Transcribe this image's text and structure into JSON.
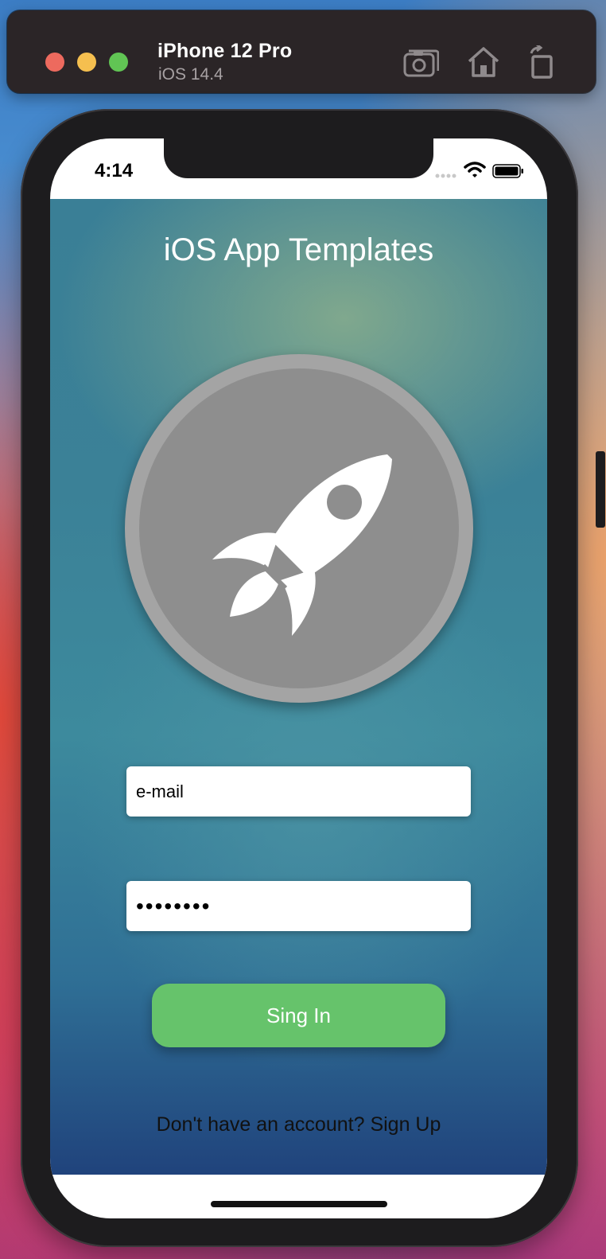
{
  "simulator": {
    "device_name": "iPhone 12 Pro",
    "os_version": "iOS 14.4",
    "toolbar": {
      "screenshot_icon": "camera-icon",
      "home_icon": "home-icon",
      "rotate_icon": "rotate-icon"
    }
  },
  "status_bar": {
    "time": "4:14",
    "wifi_icon": "wifi-icon",
    "battery_icon": "battery-icon"
  },
  "app": {
    "title": "iOS App Templates",
    "logo_icon": "rocket-icon",
    "email_placeholder": "e-mail",
    "email_value": "e-mail",
    "password_value": "••••••••",
    "signin_label": "Sing In",
    "signup_prompt": "Don't have an account? ",
    "signup_link": "Sign Up"
  },
  "colors": {
    "signin_button": "#66c36b",
    "logo_ring": "#a4a4a4",
    "logo_fill": "#8e8e8e",
    "close": "#ed6a5e",
    "minimize": "#f5bf4f",
    "maximize": "#61c554"
  }
}
